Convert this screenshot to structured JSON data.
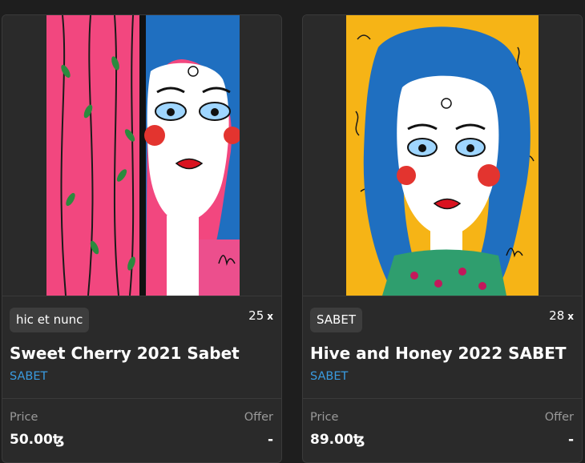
{
  "cards": [
    {
      "tag": "hic et nunc",
      "editions": "25",
      "editions_suffix": "x",
      "title": "Sweet Cherry 2021 Sabet",
      "artist": "SABET",
      "price_label": "Price",
      "price_value": "50.00ꜩ",
      "offer_label": "Offer",
      "offer_value": "-"
    },
    {
      "tag": "SABET",
      "editions": "28",
      "editions_suffix": "x",
      "title": "Hive and Honey 2022 SABET",
      "artist": "SABET",
      "price_label": "Price",
      "price_value": "89.00ꜩ",
      "offer_label": "Offer",
      "offer_value": "-"
    }
  ],
  "colors": {
    "background": "#1e1e1e",
    "card": "#2a2a2a",
    "tag": "#3d3d3d",
    "artist_link": "#3a9be0",
    "artwork1_background": "#f2477f",
    "artwork2_background": "#f6b416",
    "hair": "#1f6fc0"
  }
}
